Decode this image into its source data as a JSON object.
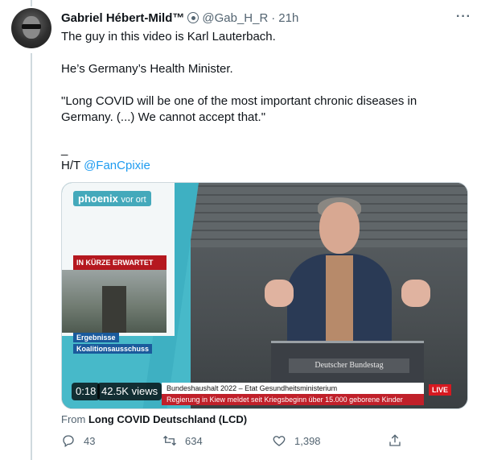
{
  "tweet": {
    "author_name": "Gabriel Hébert-Mild™",
    "author_handle": "@Gab_H_R",
    "separator": "·",
    "time": "21h",
    "more_label": "···",
    "lines": [
      "The guy in this video is Karl Lauterbach.",
      "He’s Germany’s Health Minister.",
      "\"Long COVID will be one of the most important chronic diseases in",
      "Germany. (...) We cannot accept that.\"",
      "_"
    ],
    "ht_prefix": "H/T",
    "ht_mention": "@FanCpixie"
  },
  "video": {
    "duration": "0:18",
    "views": "42.5K views",
    "channel_logo_main": "phoenix",
    "channel_logo_sub": "vor ort",
    "banner_upcoming": "IN KÜRZE ERWARTET",
    "tag_line1": "Ergebnisse",
    "tag_line2": "Koalitionsausschuss",
    "lectern_text": "Deutscher Bundestag",
    "lower_third_title": "Bundeshaushalt 2022 – Etat Gesundheitsministerium",
    "lower_third_ticker": "Regierung in Kiew meldet seit Kriegsbeginn über 15.000 geborene Kinder",
    "live_label": "LIVE"
  },
  "source": {
    "prefix": "From",
    "name": "Long COVID Deutschland (LCD)"
  },
  "actions": {
    "replies": "43",
    "retweets": "634",
    "likes": "1,398"
  },
  "colors": {
    "link": "#1d9bf0",
    "text_primary": "#0f1419",
    "text_secondary": "#536471"
  },
  "icons": [
    "verified-badge-icon",
    "more-icon",
    "reply-icon",
    "retweet-icon",
    "like-icon",
    "share-icon"
  ]
}
